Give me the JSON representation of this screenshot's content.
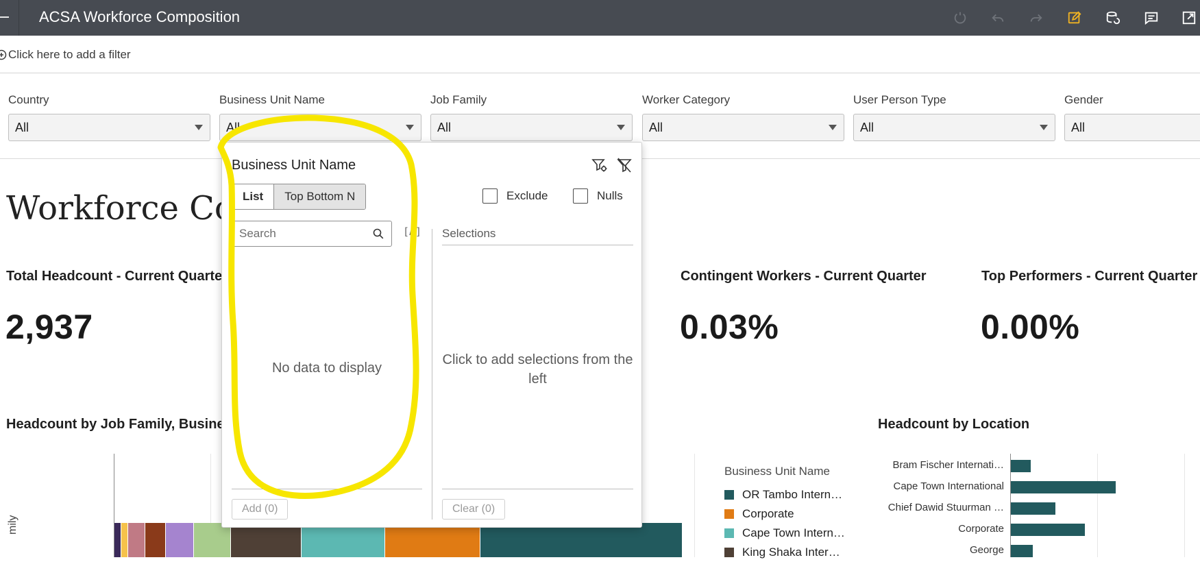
{
  "app": {
    "title": "ACSA Workforce Composition"
  },
  "toolbar": {
    "icons": [
      "refresh-icon",
      "undo-icon",
      "redo-icon",
      "edit-icon",
      "data-refresh-icon",
      "comment-icon",
      "expand-icon"
    ],
    "accent": "#f0b323"
  },
  "filterbar": {
    "add_filter_label": "Click here to add a filter"
  },
  "prompts": [
    {
      "label": "Country",
      "value": "All"
    },
    {
      "label": "Business Unit Name",
      "value": "All"
    },
    {
      "label": "Job Family",
      "value": "All"
    },
    {
      "label": "Worker Category",
      "value": "All"
    },
    {
      "label": "User Person Type",
      "value": "All"
    },
    {
      "label": "Gender",
      "value": "All"
    }
  ],
  "canvas": {
    "title": "Workforce Com"
  },
  "kpis": [
    {
      "title": "Total Headcount - Current Quarter",
      "value": "2,937"
    },
    {
      "title": "Contingent Workers - Current Quarter",
      "value": "0.03%"
    },
    {
      "title": "Top Performers - Current Quarter",
      "value": "0.00%"
    }
  ],
  "sections": {
    "headcount_job_family": "Headcount by Job Family, Business",
    "headcount_location": "Headcount by Location",
    "y_axis_label": "mily"
  },
  "legend": {
    "title": "Business Unit Name",
    "items": [
      {
        "label": "OR Tambo Intern…",
        "color": "#225a5e"
      },
      {
        "label": "Corporate",
        "color": "#e07b14"
      },
      {
        "label": "Cape Town Intern…",
        "color": "#5cb8b2"
      },
      {
        "label": "King Shaka Inter…",
        "color": "#4f4036"
      }
    ]
  },
  "stacked_bar_colors": [
    "#3b2a5a",
    "#f6c24b",
    "#c07a85",
    "#8a3a1a",
    "#a584cf",
    "#a8cc8c",
    "#4f4036",
    "#5cb8b2",
    "#e07b14",
    "#225a5e"
  ],
  "stacked_bar_fractions": [
    0.012,
    0.012,
    0.03,
    0.036,
    0.05,
    0.065,
    0.124,
    0.147,
    0.168,
    0.356
  ],
  "chart_data": {
    "type": "bar",
    "title": "Headcount by Location",
    "categories": [
      "Bram Fischer Internati…",
      "Cape Town International",
      "Chief Dawid Stuurman …",
      "Corporate",
      "George"
    ],
    "values": [
      0.18,
      0.95,
      0.4,
      0.67,
      0.2
    ],
    "xlim": [
      0,
      1.2
    ]
  },
  "popup": {
    "title": "Business Unit Name",
    "tabs": [
      "List",
      "Top Bottom N"
    ],
    "exclude_label": "Exclude",
    "nulls_label": "Nulls",
    "search_placeholder": "Search",
    "case_toggle": "[A]",
    "selections_label": "Selections",
    "no_data": "No data to display",
    "selection_hint": "Click to add selections from the left",
    "add_button": "Add (0)",
    "clear_button": "Clear (0)"
  }
}
